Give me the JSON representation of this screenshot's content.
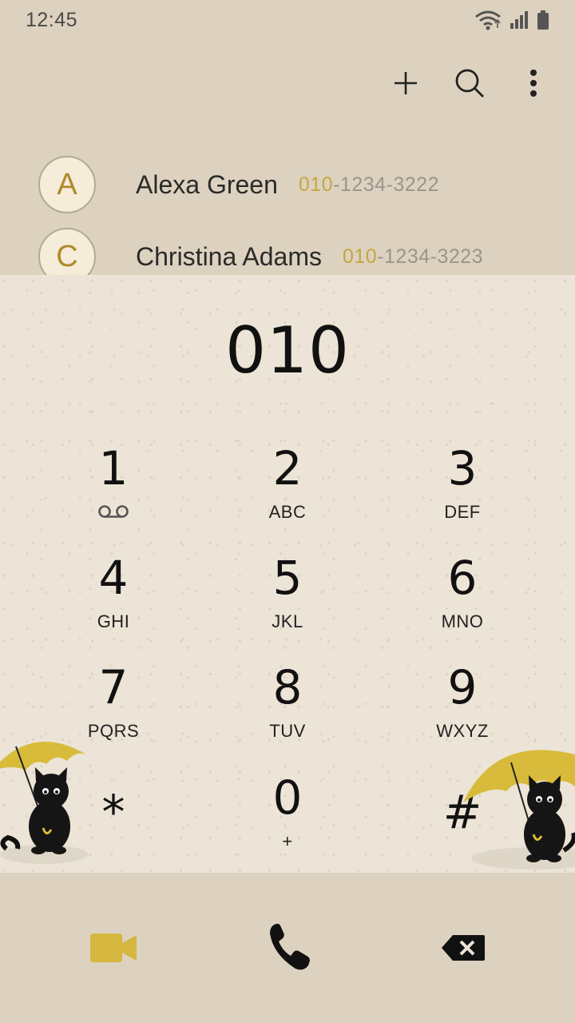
{
  "status_bar": {
    "time": "12:45"
  },
  "contacts": [
    {
      "initial": "A",
      "name": "Alexa Green",
      "number_match": "010",
      "number_rest": "-1234-3222"
    },
    {
      "initial": "C",
      "name": "Christina Adams",
      "number_match": "010",
      "number_rest": "-1234-3223"
    }
  ],
  "dialer": {
    "dialed": "010",
    "keys": [
      {
        "digit": "1",
        "letters": ""
      },
      {
        "digit": "2",
        "letters": "ABC"
      },
      {
        "digit": "3",
        "letters": "DEF"
      },
      {
        "digit": "4",
        "letters": "GHI"
      },
      {
        "digit": "5",
        "letters": "JKL"
      },
      {
        "digit": "6",
        "letters": "MNO"
      },
      {
        "digit": "7",
        "letters": "PQRS"
      },
      {
        "digit": "8",
        "letters": "TUV"
      },
      {
        "digit": "9",
        "letters": "WXYZ"
      },
      {
        "digit": "*",
        "letters": ""
      },
      {
        "digit": "0",
        "letters": "+"
      },
      {
        "digit": "#",
        "letters": ""
      }
    ]
  },
  "icons": {
    "add": "plus-icon",
    "search": "search-icon",
    "more": "more-vertical-icon",
    "voicemail": "voicemail-icon",
    "video_call": "video-camera-icon",
    "call": "phone-icon",
    "backspace": "backspace-icon"
  },
  "colors": {
    "background": "#ddd2bf",
    "paper": "#ece4d6",
    "accent_gold": "#c6a640",
    "text_dark": "#111111"
  }
}
